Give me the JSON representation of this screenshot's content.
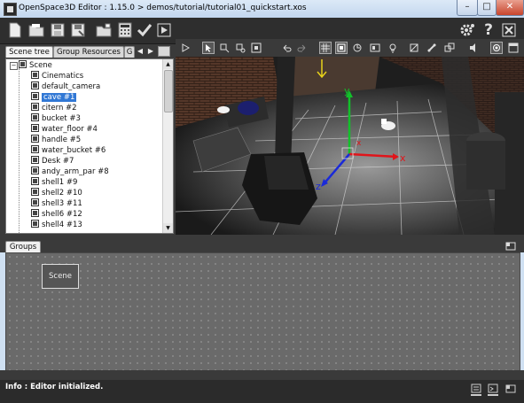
{
  "window": {
    "title": "OpenSpace3D Editor : 1.15.0 > demos/tutorial/tutorial01_quickstart.xos",
    "minimize_label": "–",
    "maximize_label": "□",
    "close_label": "✕"
  },
  "toolbar": {
    "left_icons": [
      "new-file-icon",
      "open-folder-icon",
      "save-icon",
      "save-as-icon",
      "open-project-icon",
      "calculator-icon",
      "check-icon",
      "play-icon"
    ],
    "right_icons": [
      "settings-icon",
      "help-icon",
      "exit-icon"
    ]
  },
  "left_panel": {
    "tabs": [
      {
        "label": "Scene tree",
        "active": true
      },
      {
        "label": "Group Resources",
        "active": false
      },
      {
        "label": "G",
        "active": false
      }
    ],
    "tree": {
      "root": "Scene",
      "items": [
        {
          "label": "Cinematics",
          "selected": false
        },
        {
          "label": "default_camera",
          "selected": false
        },
        {
          "label": "cave #1",
          "selected": true
        },
        {
          "label": "citern #2",
          "selected": false
        },
        {
          "label": "bucket #3",
          "selected": false
        },
        {
          "label": "water_floor #4",
          "selected": false
        },
        {
          "label": "handle #5",
          "selected": false
        },
        {
          "label": "water_bucket #6",
          "selected": false
        },
        {
          "label": "Desk #7",
          "selected": false
        },
        {
          "label": "andy_arm_par #8",
          "selected": false
        },
        {
          "label": "shell1 #9",
          "selected": false
        },
        {
          "label": "shell2 #10",
          "selected": false
        },
        {
          "label": "shell3 #11",
          "selected": false
        },
        {
          "label": "shell6 #12",
          "selected": false
        },
        {
          "label": "shell4 #13",
          "selected": false
        }
      ]
    }
  },
  "viewport": {
    "axes": {
      "x": "x",
      "y": "y",
      "z": "z"
    },
    "colors": {
      "x_axis": "#e0151b",
      "y_axis": "#12c02a",
      "z_axis": "#1a2ad8",
      "light_marker": "#e8d21a"
    }
  },
  "groups": {
    "tab_label": "Groups",
    "nodes": [
      {
        "label": "Scene"
      }
    ]
  },
  "status": {
    "text": "Info : Editor initialized."
  },
  "colors": {
    "panel_bg": "#3a3a3a",
    "selection": "#3178d5"
  }
}
